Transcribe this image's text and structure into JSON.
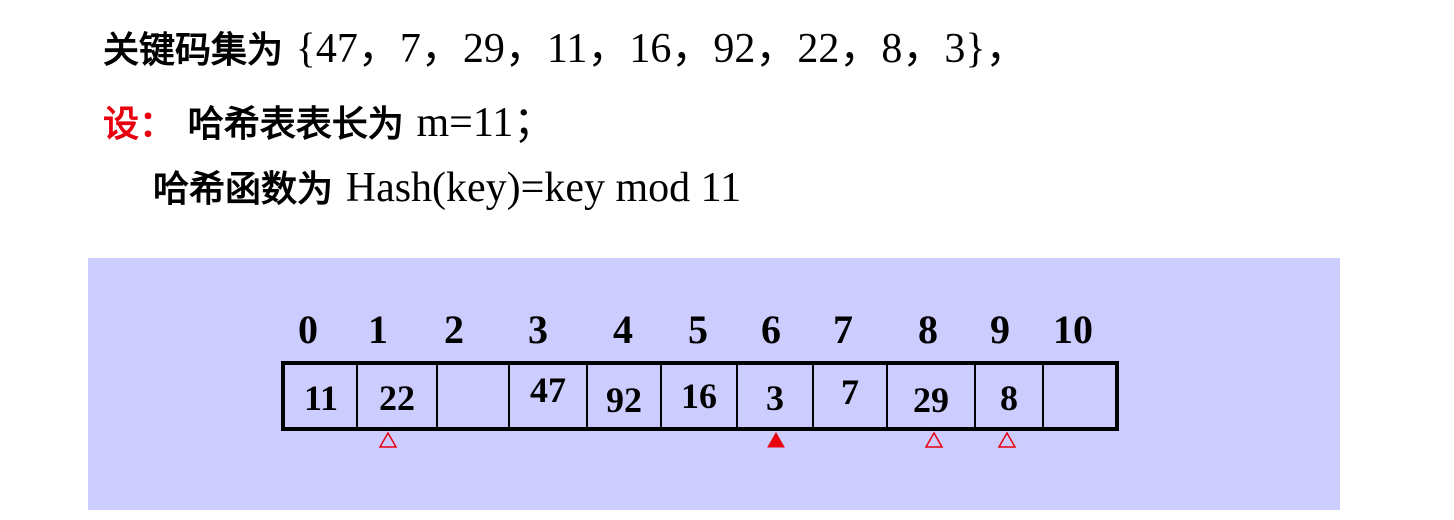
{
  "line1": {
    "label": "关键码集为",
    "set": "{47，7，29，11，16，92，22，8，3}，"
  },
  "line2": {
    "prefix": "设：",
    "text": "哈希表表长为",
    "formula": "m=11；"
  },
  "line3": {
    "text": "哈希函数为",
    "formula": "Hash(key)=key mod 11"
  },
  "table": {
    "indices": [
      "0",
      "1",
      "2",
      "3",
      "4",
      "5",
      "6",
      "7",
      "8",
      "9",
      "10"
    ],
    "values": [
      "11",
      "22",
      "",
      "47",
      "92",
      "16",
      "3",
      "7",
      "29",
      "8",
      ""
    ]
  },
  "markers": [
    {
      "slot": 1,
      "type": "hollow-triangle"
    },
    {
      "slot": 6,
      "type": "filled-triangle"
    },
    {
      "slot": 8,
      "type": "hollow-triangle"
    },
    {
      "slot": 9,
      "type": "hollow-triangle"
    }
  ],
  "colors": {
    "panel": "#ccccff",
    "accent": "#e8000f"
  }
}
